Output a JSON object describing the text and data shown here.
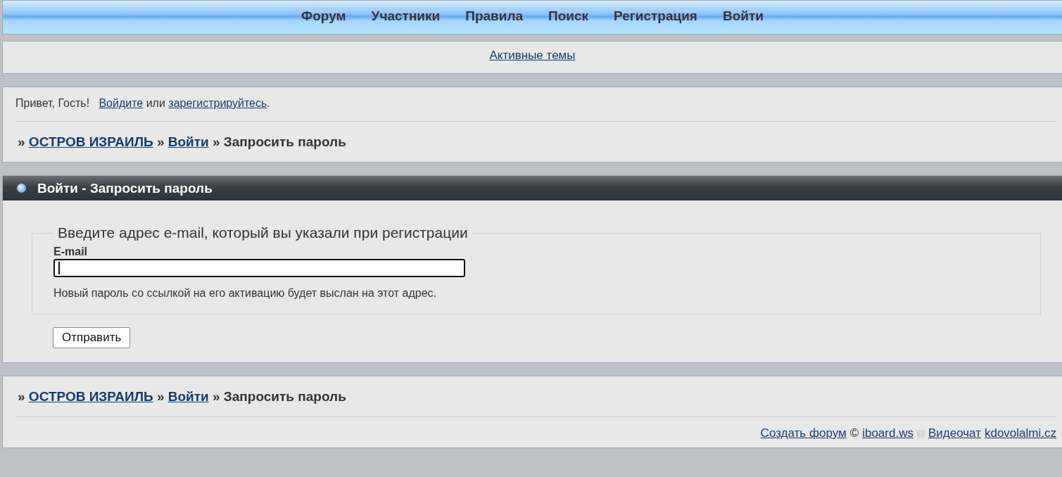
{
  "nav": {
    "items": [
      {
        "label": "Форум"
      },
      {
        "label": "Участники"
      },
      {
        "label": "Правила"
      },
      {
        "label": "Поиск"
      },
      {
        "label": "Регистрация"
      },
      {
        "label": "Войти"
      }
    ]
  },
  "active_topics": {
    "label": "Активные темы"
  },
  "welcome": {
    "parts": [
      {
        "kind": "text",
        "text": "Привет, Гость!   "
      },
      {
        "kind": "link",
        "text": "Войдите"
      },
      {
        "kind": "text",
        "text": " или "
      },
      {
        "kind": "link",
        "text": "зарегистрируйтесь"
      },
      {
        "kind": "text",
        "text": "."
      }
    ]
  },
  "breadcrumb_top": [
    {
      "kind": "sep",
      "text": "» "
    },
    {
      "kind": "link",
      "text": "ОСТРОВ ИЗРАИЛЬ"
    },
    {
      "kind": "sep",
      "text": " » "
    },
    {
      "kind": "link",
      "text": "Войти"
    },
    {
      "kind": "sep",
      "text": " » Запросить пароль"
    }
  ],
  "form": {
    "title": "Войти - Запросить пароль",
    "legend": "Введите адрес e-mail, который вы указали при регистрации",
    "field_label": "E-mail",
    "field_focused": true,
    "hint": "Новый пароль со ссылкой на его активацию будет выслан на этот адрес.",
    "submit": "Отправить"
  },
  "breadcrumb_bottom": [
    {
      "kind": "sep",
      "text": "» "
    },
    {
      "kind": "link",
      "text": "ОСТРОВ ИЗРАИЛЬ"
    },
    {
      "kind": "sep",
      "text": " » "
    },
    {
      "kind": "link",
      "text": "Войти"
    },
    {
      "kind": "sep",
      "text": " » Запросить пароль"
    }
  ],
  "footer": [
    {
      "kind": "link",
      "text": "Создать форум"
    },
    {
      "kind": "text",
      "text": "©"
    },
    {
      "kind": "link",
      "text": "iboard.ws"
    },
    {
      "kind": "icon"
    },
    {
      "kind": "link",
      "text": "Видеочат"
    },
    {
      "kind": "link",
      "text": "kdovolalmi.cz"
    }
  ]
}
